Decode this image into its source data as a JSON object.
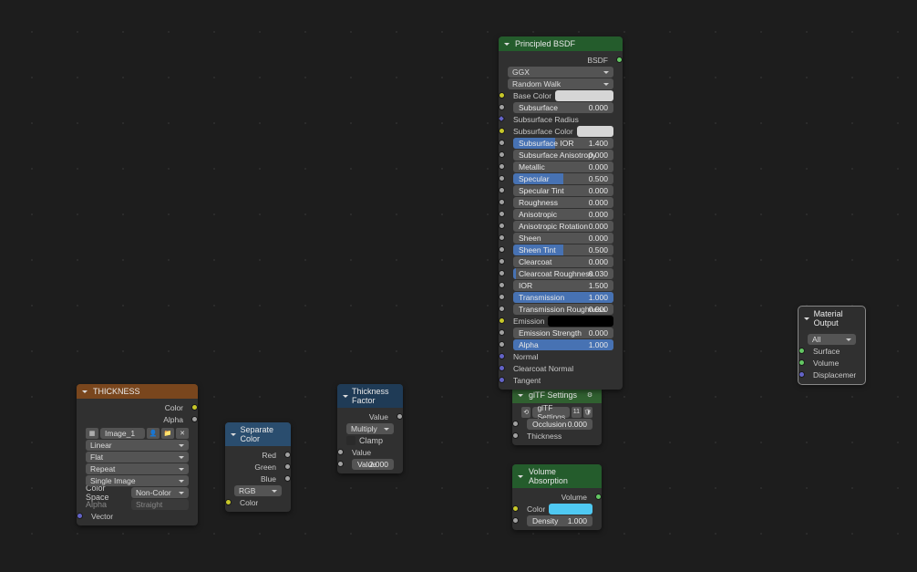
{
  "thickness_node": {
    "title": "THICKNESS",
    "out_color": "Color",
    "out_alpha": "Alpha",
    "image_name": "Image_1",
    "interp": "Linear",
    "proj": "Flat",
    "ext": "Repeat",
    "source": "Single Image",
    "cs_label": "Color Space",
    "cs_value": "Non-Color",
    "alpha_label": "Alpha",
    "alpha_value": "Straight",
    "vector": "Vector"
  },
  "separate": {
    "title": "Separate Color",
    "red": "Red",
    "green": "Green",
    "blue": "Blue",
    "mode": "RGB",
    "color": "Color"
  },
  "tf": {
    "title": "Thickness Factor",
    "out": "Value",
    "mode": "Multiply",
    "clamp": "Clamp",
    "in_value": "Value",
    "slider_label": "Value",
    "slider_value": "2.000"
  },
  "gltf": {
    "title": "glTF Settings",
    "group_label": "glTF Settings",
    "group_num": "11",
    "occlusion_label": "Occlusion",
    "occlusion_value": "0.000",
    "thickness": "Thickness"
  },
  "vabs": {
    "title": "Volume Absorption",
    "out": "Volume",
    "color": "Color",
    "density_label": "Density",
    "density_value": "1.000"
  },
  "pbsdf": {
    "title": "Principled BSDF",
    "out": "BSDF",
    "dist": "GGX",
    "sss_method": "Random Walk",
    "base_color": "Base Color",
    "rows": [
      {
        "label": "Subsurface",
        "value": "0.000",
        "fill": 0
      },
      {
        "label": "Subsurface Radius",
        "value": "",
        "fill": -1,
        "vector": true
      },
      {
        "label": "Subsurface Color",
        "value": "",
        "fill": -2,
        "swatch": "#d6d6d6"
      },
      {
        "label": "Subsurface IOR",
        "value": "1.400",
        "fill": 42
      },
      {
        "label": "Subsurface Anisotropy",
        "value": "0.000",
        "fill": 0
      },
      {
        "label": "Metallic",
        "value": "0.000",
        "fill": 0
      },
      {
        "label": "Specular",
        "value": "0.500",
        "fill": 50
      },
      {
        "label": "Specular Tint",
        "value": "0.000",
        "fill": 0
      },
      {
        "label": "Roughness",
        "value": "0.000",
        "fill": 0
      },
      {
        "label": "Anisotropic",
        "value": "0.000",
        "fill": 0
      },
      {
        "label": "Anisotropic Rotation",
        "value": "0.000",
        "fill": 0
      },
      {
        "label": "Sheen",
        "value": "0.000",
        "fill": 0
      },
      {
        "label": "Sheen Tint",
        "value": "0.500",
        "fill": 50
      },
      {
        "label": "Clearcoat",
        "value": "0.000",
        "fill": 0
      },
      {
        "label": "Clearcoat Roughness",
        "value": "0.030",
        "fill": 3
      },
      {
        "label": "IOR",
        "value": "1.500",
        "fill": 0
      },
      {
        "label": "Transmission",
        "value": "1.000",
        "fill": 100
      },
      {
        "label": "Transmission Roughness",
        "value": "0.000",
        "fill": 0
      }
    ],
    "emission": "Emission",
    "em_strength_label": "Emission Strength",
    "em_strength_value": "0.000",
    "alpha_label": "Alpha",
    "alpha_value": "1.000",
    "normal": "Normal",
    "cc_normal": "Clearcoat Normal",
    "tangent": "Tangent"
  },
  "matout": {
    "title": "Material Output",
    "target": "All",
    "surface": "Surface",
    "volume": "Volume",
    "disp": "Displacement"
  }
}
